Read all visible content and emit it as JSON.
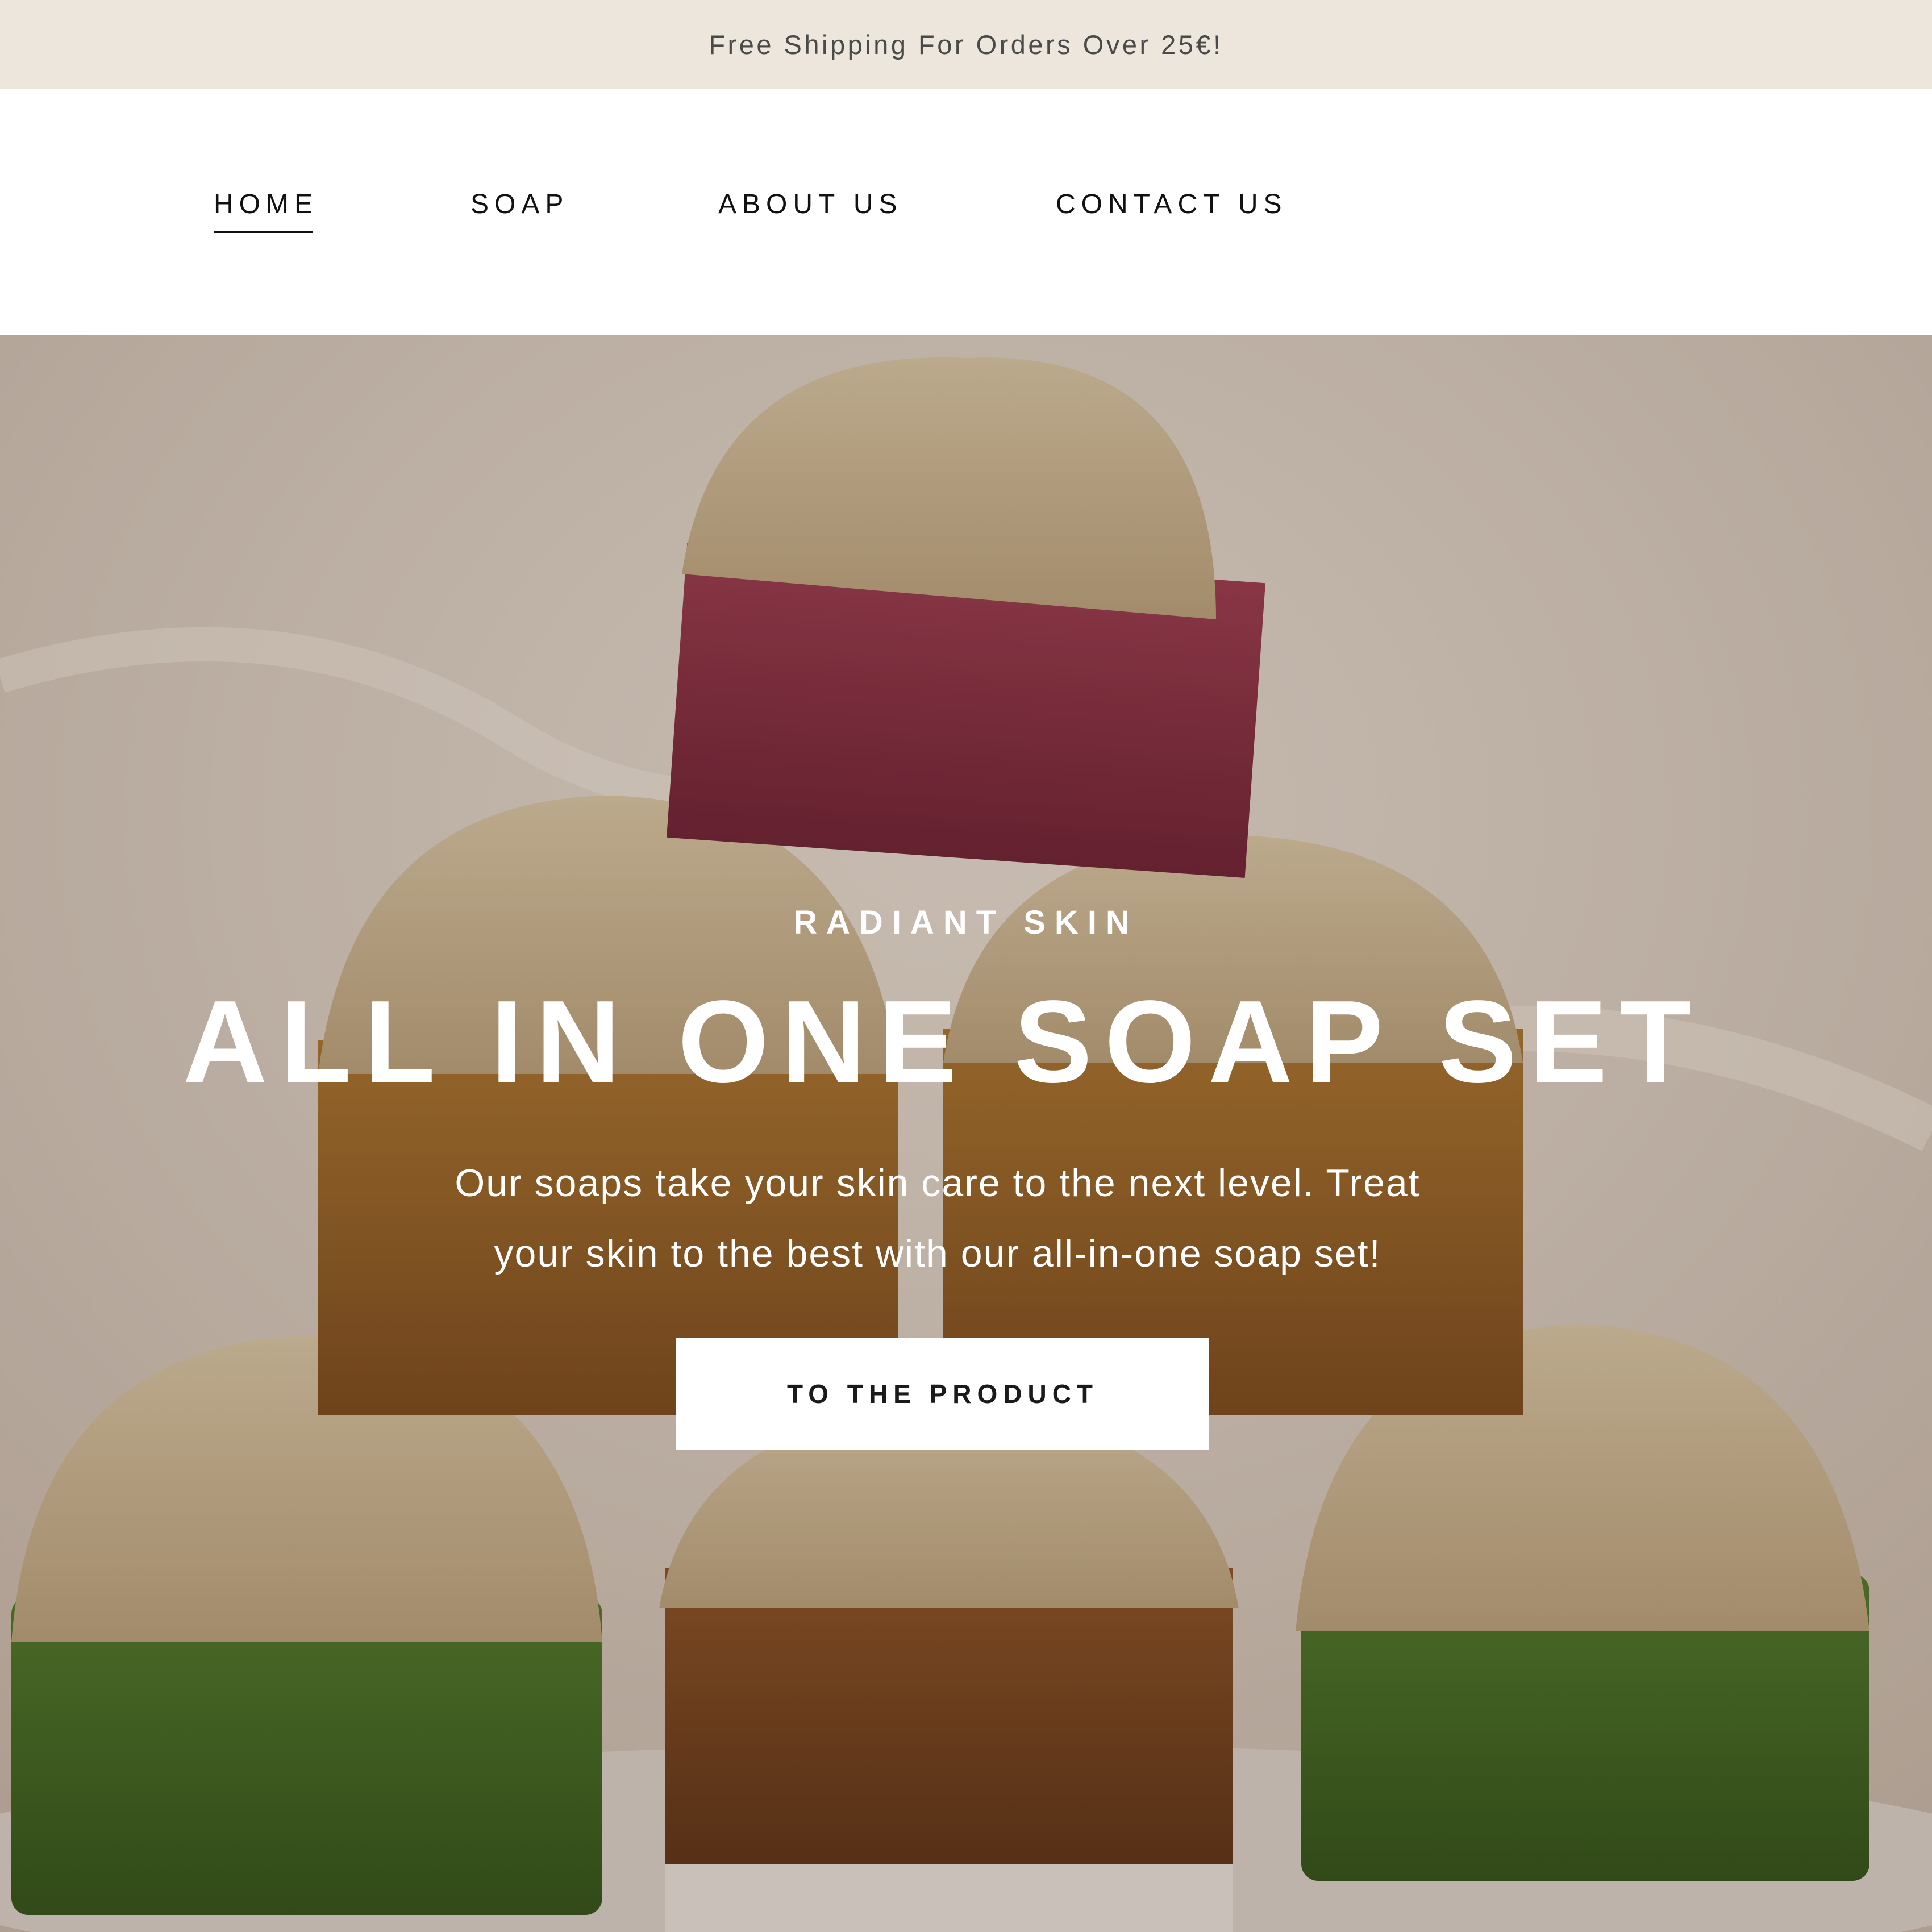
{
  "announcement": {
    "text": "Free Shipping For Orders Over 25€!"
  },
  "nav": {
    "items": [
      {
        "label": "HOME",
        "active": true
      },
      {
        "label": "SOAP",
        "active": false
      },
      {
        "label": "ABOUT US",
        "active": false
      },
      {
        "label": "CONTACT US",
        "active": false
      }
    ]
  },
  "hero": {
    "eyebrow": "RADIANT SKIN",
    "title": "ALL IN ONE SOAP SET",
    "text_line1": "Our soaps take your skin care to the next level. Treat",
    "text_line2": "your skin to the best with our all-in-one soap set!",
    "button_label": "TO THE PRODUCT",
    "image_subject": "stacked loofah soap bars"
  },
  "colors": {
    "announcement_bg": "#ece6dd",
    "text_dark": "#111111",
    "button_bg": "#ffffff",
    "hero_text": "#ffffff"
  }
}
